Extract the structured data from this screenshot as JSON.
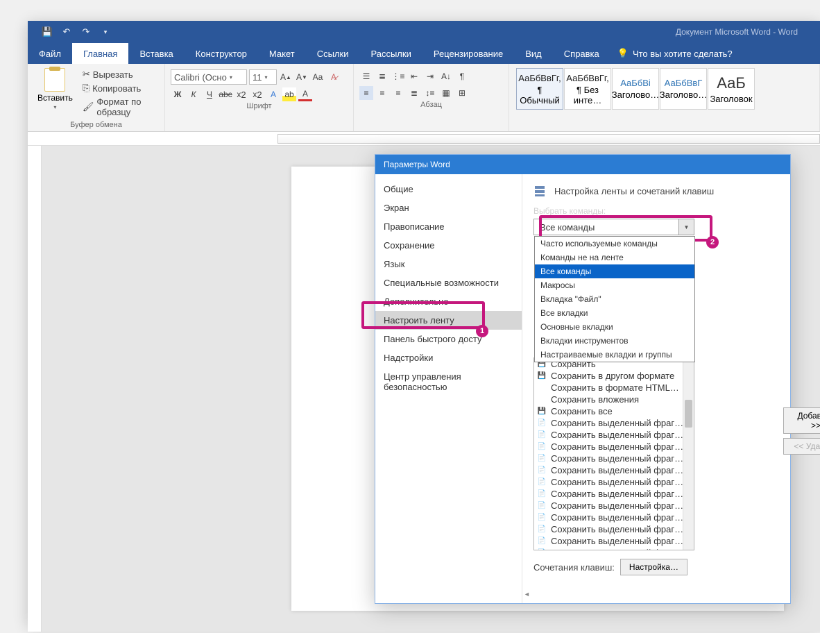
{
  "title": "Документ Microsoft Word  -  Word",
  "qat": {
    "save": "save-icon",
    "undo": "undo-icon",
    "redo": "redo-icon",
    "more": "more-icon"
  },
  "tabs": [
    "Файл",
    "Главная",
    "Вставка",
    "Конструктор",
    "Макет",
    "Ссылки",
    "Рассылки",
    "Рецензирование",
    "Вид",
    "Справка"
  ],
  "active_tab": 1,
  "tell_me": "Что вы хотите сделать?",
  "ribbon": {
    "clipboard": {
      "paste": "Вставить",
      "cut": "Вырезать",
      "copy": "Копировать",
      "format_painter": "Формат по образцу",
      "label": "Буфер обмена"
    },
    "font": {
      "name": "Calibri (Осно",
      "size": "11",
      "label": "Шрифт"
    },
    "paragraph": {
      "label": "Абзац"
    },
    "styles": {
      "items": [
        {
          "preview": "АаБбВвГг,",
          "name": "¶ Обычный",
          "sel": true
        },
        {
          "preview": "АаБбВвГг,",
          "name": "¶ Без инте…"
        },
        {
          "preview": "АаБбВі",
          "name": "Заголово…",
          "h": true
        },
        {
          "preview": "АаБбВвГ",
          "name": "Заголово…",
          "h": true
        },
        {
          "preview": "АаБ",
          "name": "Заголовок",
          "big": true
        }
      ]
    }
  },
  "dialog": {
    "title": "Параметры Word",
    "sidebar": [
      "Общие",
      "Экран",
      "Правописание",
      "Сохранение",
      "Язык",
      "Специальные возможности",
      "Дополнительно",
      "Настроить ленту",
      "Панель быстрого досту",
      "Надстройки",
      "Центр управления безопасностью"
    ],
    "selected_sidebar": 7,
    "content_title": "Настройка ленты и сочетаний клавиш",
    "commands_label": "Выбрать команды:",
    "dropdown_value": "Все команды",
    "dropdown_items": [
      "Часто используемые команды",
      "Команды не на ленте",
      "Все команды",
      "Макросы",
      "Вкладка \"Файл\"",
      "Все вкладки",
      "Основные вкладки",
      "Вкладки инструментов",
      "Настраиваемые вкладки и группы"
    ],
    "dropdown_selected": 2,
    "command_list": [
      "Сохранить",
      "Сохранить в другом формате",
      "Сохранить в формате HTML…",
      "Сохранить вложения",
      "Сохранить все",
      "Сохранить выделенный фраг…",
      "Сохранить выделенный фраг…",
      "Сохранить выделенный фраг…",
      "Сохранить выделенный фраг…",
      "Сохранить выделенный фраг…",
      "Сохранить выделенный фраг…",
      "Сохранить выделенный фраг…",
      "Сохранить выделенный фраг…",
      "Сохранить выделенный фраг…",
      "Сохранить выделенный фраг…",
      "Сохранить выделенный фраг…",
      "Сохранить выделенный фраг…"
    ],
    "shortcuts_label": "Сочетания клавиш:",
    "customize_btn": "Настройка…",
    "add_btn": "Добавить >>",
    "remove_btn": "<< Удалить"
  },
  "annotations": {
    "badge1": "1",
    "badge2": "2"
  },
  "colors": {
    "brand": "#2b579a",
    "accent": "#c5177d",
    "dialog_title": "#2b7cd3"
  }
}
